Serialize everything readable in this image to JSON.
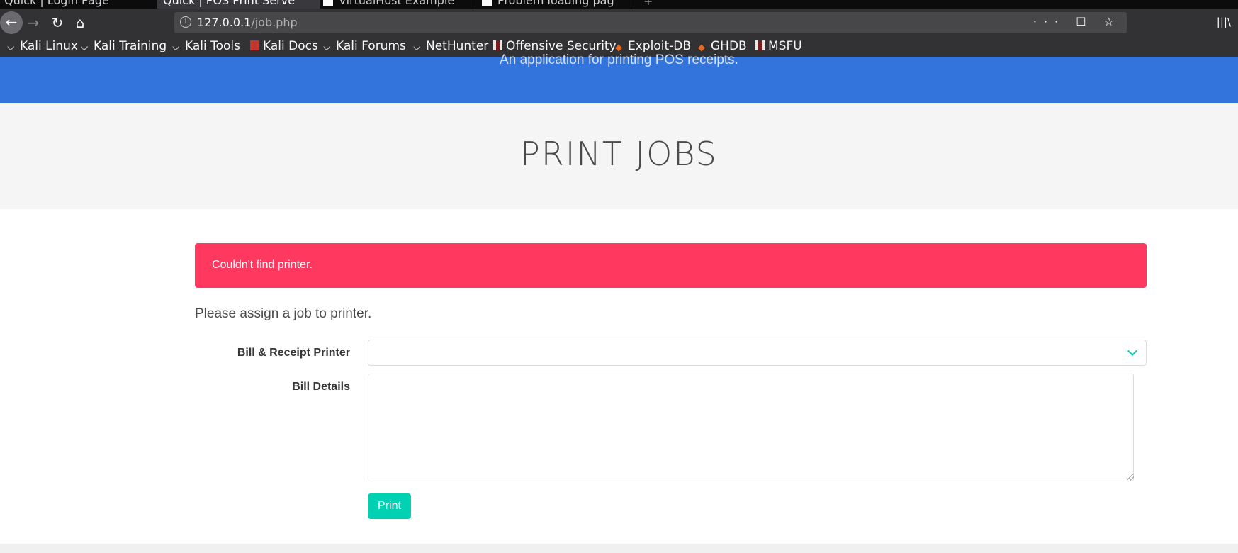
{
  "browser": {
    "tabs": [
      {
        "label": "Quick | Login Page",
        "active": false
      },
      {
        "label": "Quick | POS Print Serve",
        "active": true
      },
      {
        "label": "VirtualHost Example",
        "active": false
      },
      {
        "label": "Problem loading pag",
        "active": false
      }
    ],
    "new_tab_label": "+",
    "url": {
      "host": "127.0.0.1",
      "path": "/job.php"
    },
    "url_actions": "··· ☐ ☆",
    "bookmarks": [
      {
        "label": "Kali Linux",
        "icon": "kali-dragon-icon"
      },
      {
        "label": "Kali Training",
        "icon": "kali-dragon-icon"
      },
      {
        "label": "Kali Tools",
        "icon": "kali-dragon-icon"
      },
      {
        "label": "Kali Docs",
        "icon": "kali-docs-icon"
      },
      {
        "label": "Kali Forums",
        "icon": "kali-dragon-icon"
      },
      {
        "label": "NetHunter",
        "icon": "kali-dragon-icon"
      },
      {
        "label": "Offensive Security",
        "icon": "offsec-icon"
      },
      {
        "label": "Exploit-DB",
        "icon": "exploitdb-icon"
      },
      {
        "label": "GHDB",
        "icon": "exploitdb-icon"
      },
      {
        "label": "MSFU",
        "icon": "offsec-icon"
      }
    ]
  },
  "page": {
    "subtitle": "An application for printing POS receipts.",
    "title": "PRINT JOBS",
    "notification": "Couldn't find printer.",
    "instruction": "Please assign a job to printer.",
    "form": {
      "printer_label": "Bill & Receipt Printer",
      "printer_value": "",
      "details_label": "Bill Details",
      "details_value": "",
      "print_label": "Print"
    }
  },
  "colors": {
    "hero_blue": "#3273dc",
    "danger": "#ff3860",
    "primary": "#00d1b2"
  }
}
